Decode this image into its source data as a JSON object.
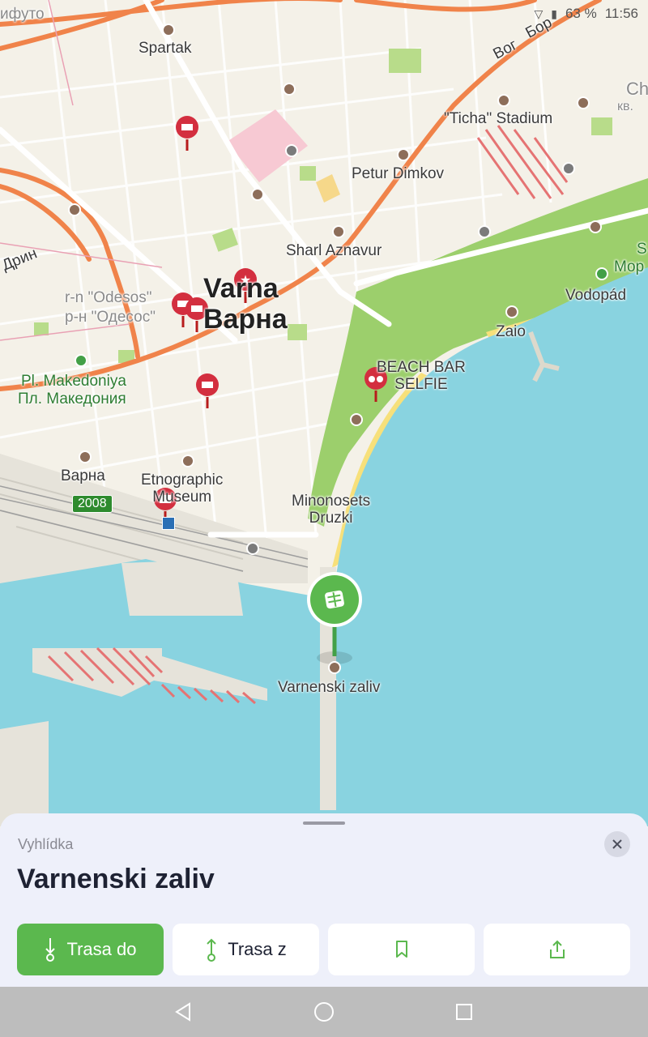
{
  "status_bar": {
    "battery": "63 %",
    "time": "11:56"
  },
  "map": {
    "labels": {
      "spartak": "Spartak",
      "ticha": "\"Ticha\" Stadium",
      "petur": "Petur Dimkov",
      "sharl": "Sharl Aznavur",
      "varna_latin": "Varna",
      "varna_cyr": "Варна",
      "odesos_latin": "r-n \"Odesos\"",
      "odesos_cyr": "р-н \"Одесос\"",
      "makedoniya_latin": "Pl. Makedoniya",
      "makedoniya_cyr": "Пл. Македония",
      "varna_station": "Варна",
      "route_number": "2008",
      "etnographic": "Etnographic\nMuseum",
      "minonosets": "Minonosets\nDruzki",
      "beach_bar": "BEACH BAR\nSELFIE",
      "zaio": "Zaio",
      "vodopad": "Vodopád",
      "varnenski": "Varnenski zaliv",
      "drin": "Дрин",
      "vog": "Вог",
      "bor": "Бор",
      "top_left": "ифуто",
      "ch": "Ch",
      "kv": "кв.",
      "mor": "Мор",
      "s": "S"
    }
  },
  "sheet": {
    "category": "Vyhlídka",
    "title": "Varnenski zaliv",
    "close_icon": "close-icon",
    "buttons": {
      "route_to": "Trasa do",
      "route_from": "Trasa z",
      "bookmark_icon": "bookmark-icon",
      "share_icon": "share-icon"
    }
  },
  "colors": {
    "accent_green": "#5bb84e",
    "sea": "#89d3e0",
    "park": "#9ccf6c",
    "road_major": "#f0834a",
    "pin_red": "#d32f3f"
  },
  "navbar": {
    "back_icon": "back-icon",
    "home_icon": "home-icon",
    "recents_icon": "recents-icon"
  }
}
